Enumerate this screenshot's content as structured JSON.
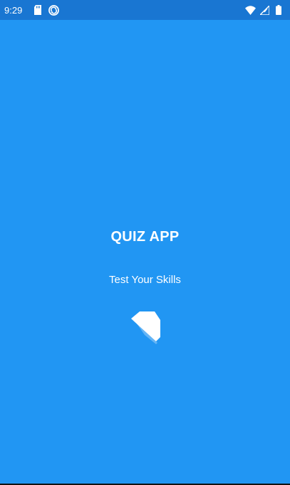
{
  "status_bar": {
    "time": "9:29",
    "left_icons": [
      "sd-card-icon",
      "sync-icon"
    ],
    "right_icons": [
      "wifi-icon",
      "cell-signal-icon",
      "battery-icon"
    ]
  },
  "splash": {
    "title": "QUIZ APP",
    "subtitle": "Test Your Skills",
    "loader_icon": "loading-spinner-icon"
  },
  "colors": {
    "background": "#2196F3",
    "status_bar": "#1976D2",
    "text": "#FFFFFF"
  }
}
